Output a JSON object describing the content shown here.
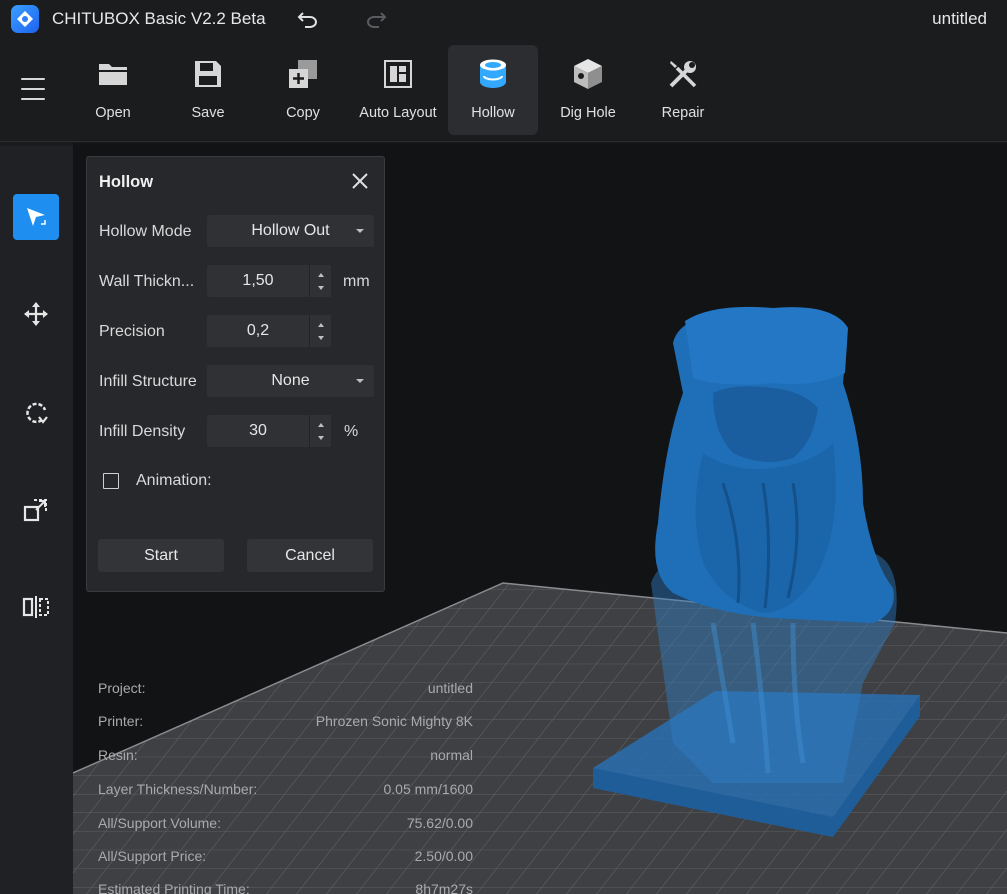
{
  "app": {
    "title": "CHITUBOX Basic V2.2 Beta",
    "file_name": "untitled"
  },
  "toolbar": {
    "items": [
      {
        "label": "Open"
      },
      {
        "label": "Save"
      },
      {
        "label": "Copy"
      },
      {
        "label": "Auto Layout"
      },
      {
        "label": "Hollow"
      },
      {
        "label": "Dig Hole"
      },
      {
        "label": "Repair"
      }
    ],
    "active": "Hollow"
  },
  "hollow_panel": {
    "title": "Hollow",
    "hollow_mode": {
      "label": "Hollow Mode",
      "value": "Hollow Out"
    },
    "wall_thickness": {
      "label": "Wall Thickn...",
      "value": "1,50",
      "unit": "mm"
    },
    "precision": {
      "label": "Precision",
      "value": "0,2"
    },
    "infill_structure": {
      "label": "Infill Structure",
      "value": "None"
    },
    "infill_density": {
      "label": "Infill Density",
      "value": "30",
      "unit": "%"
    },
    "animation": {
      "label": "Animation:",
      "checked": false
    },
    "start_label": "Start",
    "cancel_label": "Cancel"
  },
  "project_info": [
    {
      "key": "Project:",
      "value": "untitled"
    },
    {
      "key": "Printer:",
      "value": "Phrozen Sonic Mighty 8K"
    },
    {
      "key": "Resin:",
      "value": "normal"
    },
    {
      "key": "Layer Thickness/Number:",
      "value": "0.05 mm/1600"
    },
    {
      "key": "All/Support Volume:",
      "value": "75.62/0.00"
    },
    {
      "key": "All/Support Price:",
      "value": "2.50/0.00"
    },
    {
      "key": "Estimated Printing Time:",
      "value": "8h7m27s"
    }
  ],
  "colors": {
    "accent": "#1e8ef0",
    "model": "#1f6fb8",
    "background": "#121314"
  }
}
